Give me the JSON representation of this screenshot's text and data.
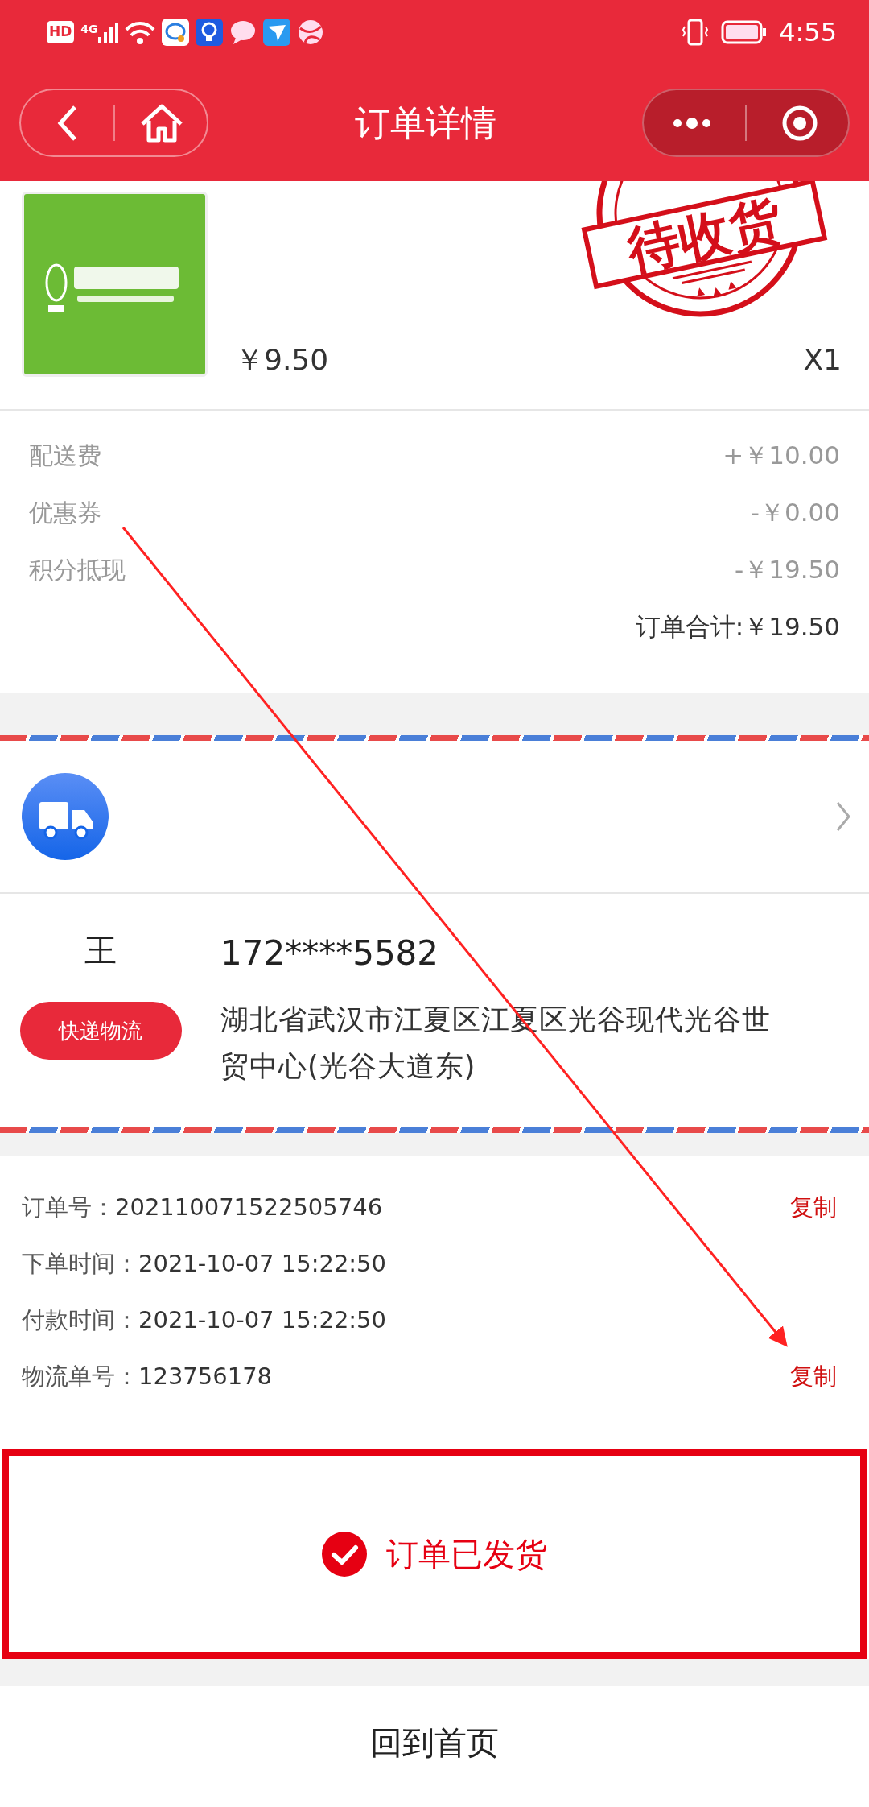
{
  "status_bar": {
    "network_badge": "HD",
    "signal_label": "4G",
    "time": "4:55"
  },
  "header": {
    "title": "订单详情"
  },
  "stamp": {
    "text": "待收货"
  },
  "product": {
    "kind": "picture",
    "price": "￥9.50",
    "quantity": "X1"
  },
  "fees": [
    {
      "label": "配送费",
      "amount": "+￥10.00"
    },
    {
      "label": "优惠券",
      "amount": "-￥0.00"
    },
    {
      "label": "积分抵现",
      "amount": "-￥19.50"
    }
  ],
  "total": "订单合计:￥19.50",
  "recipient": {
    "name": "王",
    "tag": "快递物流",
    "phone": "172****5582",
    "address": "湖北省武汉市江夏区江夏区光谷现代光谷世贸中心(光谷大道东)"
  },
  "order_info": [
    {
      "label": "订单号：",
      "value": "202110071522505746",
      "action": "复制"
    },
    {
      "label": "下单时间：",
      "value": "2021-10-07 15:22:50"
    },
    {
      "label": "付款时间：",
      "value": "2021-10-07 15:22:50"
    },
    {
      "label": "物流单号：",
      "value": "123756178",
      "action": "复制"
    }
  ],
  "status_banner": {
    "text": "订单已发货"
  },
  "home_button": "回到首页"
}
